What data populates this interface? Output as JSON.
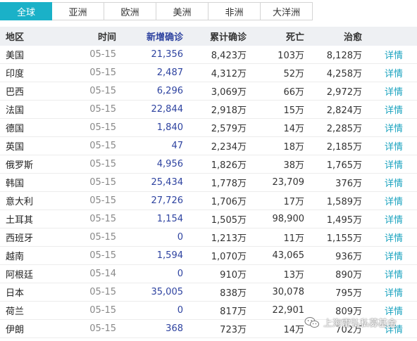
{
  "tabs": [
    {
      "label": "全球",
      "active": true
    },
    {
      "label": "亚洲",
      "active": false
    },
    {
      "label": "欧洲",
      "active": false
    },
    {
      "label": "美洲",
      "active": false
    },
    {
      "label": "非洲",
      "active": false
    },
    {
      "label": "大洋洲",
      "active": false
    }
  ],
  "columns": {
    "region": "地区",
    "date": "时间",
    "new_confirmed": "新增确诊",
    "total_confirmed": "累计确诊",
    "deaths": "死亡",
    "recovered": "治愈"
  },
  "rows": [
    {
      "region": "美国",
      "date": "05-15",
      "new_confirmed": "21,356",
      "total_confirmed": "8,423万",
      "deaths": "103万",
      "recovered": "8,128万",
      "link": "详情"
    },
    {
      "region": "印度",
      "date": "05-15",
      "new_confirmed": "2,487",
      "total_confirmed": "4,312万",
      "deaths": "52万",
      "recovered": "4,258万",
      "link": "详情"
    },
    {
      "region": "巴西",
      "date": "05-15",
      "new_confirmed": "6,296",
      "total_confirmed": "3,069万",
      "deaths": "66万",
      "recovered": "2,972万",
      "link": "详情"
    },
    {
      "region": "法国",
      "date": "05-15",
      "new_confirmed": "22,844",
      "total_confirmed": "2,918万",
      "deaths": "15万",
      "recovered": "2,824万",
      "link": "详情"
    },
    {
      "region": "德国",
      "date": "05-15",
      "new_confirmed": "1,840",
      "total_confirmed": "2,579万",
      "deaths": "14万",
      "recovered": "2,285万",
      "link": "详情"
    },
    {
      "region": "英国",
      "date": "05-15",
      "new_confirmed": "47",
      "total_confirmed": "2,234万",
      "deaths": "18万",
      "recovered": "2,185万",
      "link": "详情"
    },
    {
      "region": "俄罗斯",
      "date": "05-15",
      "new_confirmed": "4,956",
      "total_confirmed": "1,826万",
      "deaths": "38万",
      "recovered": "1,765万",
      "link": "详情"
    },
    {
      "region": "韩国",
      "date": "05-15",
      "new_confirmed": "25,434",
      "total_confirmed": "1,778万",
      "deaths": "23,709",
      "recovered": "376万",
      "link": "详情"
    },
    {
      "region": "意大利",
      "date": "05-15",
      "new_confirmed": "27,726",
      "total_confirmed": "1,706万",
      "deaths": "17万",
      "recovered": "1,589万",
      "link": "详情"
    },
    {
      "region": "土耳其",
      "date": "05-15",
      "new_confirmed": "1,154",
      "total_confirmed": "1,505万",
      "deaths": "98,900",
      "recovered": "1,495万",
      "link": "详情"
    },
    {
      "region": "西班牙",
      "date": "05-15",
      "new_confirmed": "0",
      "total_confirmed": "1,213万",
      "deaths": "11万",
      "recovered": "1,155万",
      "link": "详情"
    },
    {
      "region": "越南",
      "date": "05-15",
      "new_confirmed": "1,594",
      "total_confirmed": "1,070万",
      "deaths": "43,065",
      "recovered": "936万",
      "link": "详情"
    },
    {
      "region": "阿根廷",
      "date": "05-14",
      "new_confirmed": "0",
      "total_confirmed": "910万",
      "deaths": "13万",
      "recovered": "890万",
      "link": "详情"
    },
    {
      "region": "日本",
      "date": "05-15",
      "new_confirmed": "35,005",
      "total_confirmed": "838万",
      "deaths": "30,078",
      "recovered": "795万",
      "link": "详情"
    },
    {
      "region": "荷兰",
      "date": "05-15",
      "new_confirmed": "0",
      "total_confirmed": "817万",
      "deaths": "22,901",
      "recovered": "809万",
      "link": "详情"
    },
    {
      "region": "伊朗",
      "date": "05-15",
      "new_confirmed": "368",
      "total_confirmed": "723万",
      "deaths": "14万",
      "recovered": "702万",
      "link": "详情"
    }
  ],
  "watermark": {
    "text": "上海雷弘私募基金",
    "icon": "wechat-icon"
  },
  "colors": {
    "accent": "#1ab1c8",
    "new_confirmed": "#2e43a0",
    "link": "#1aa3bf",
    "header_bg": "#eef0f3"
  }
}
